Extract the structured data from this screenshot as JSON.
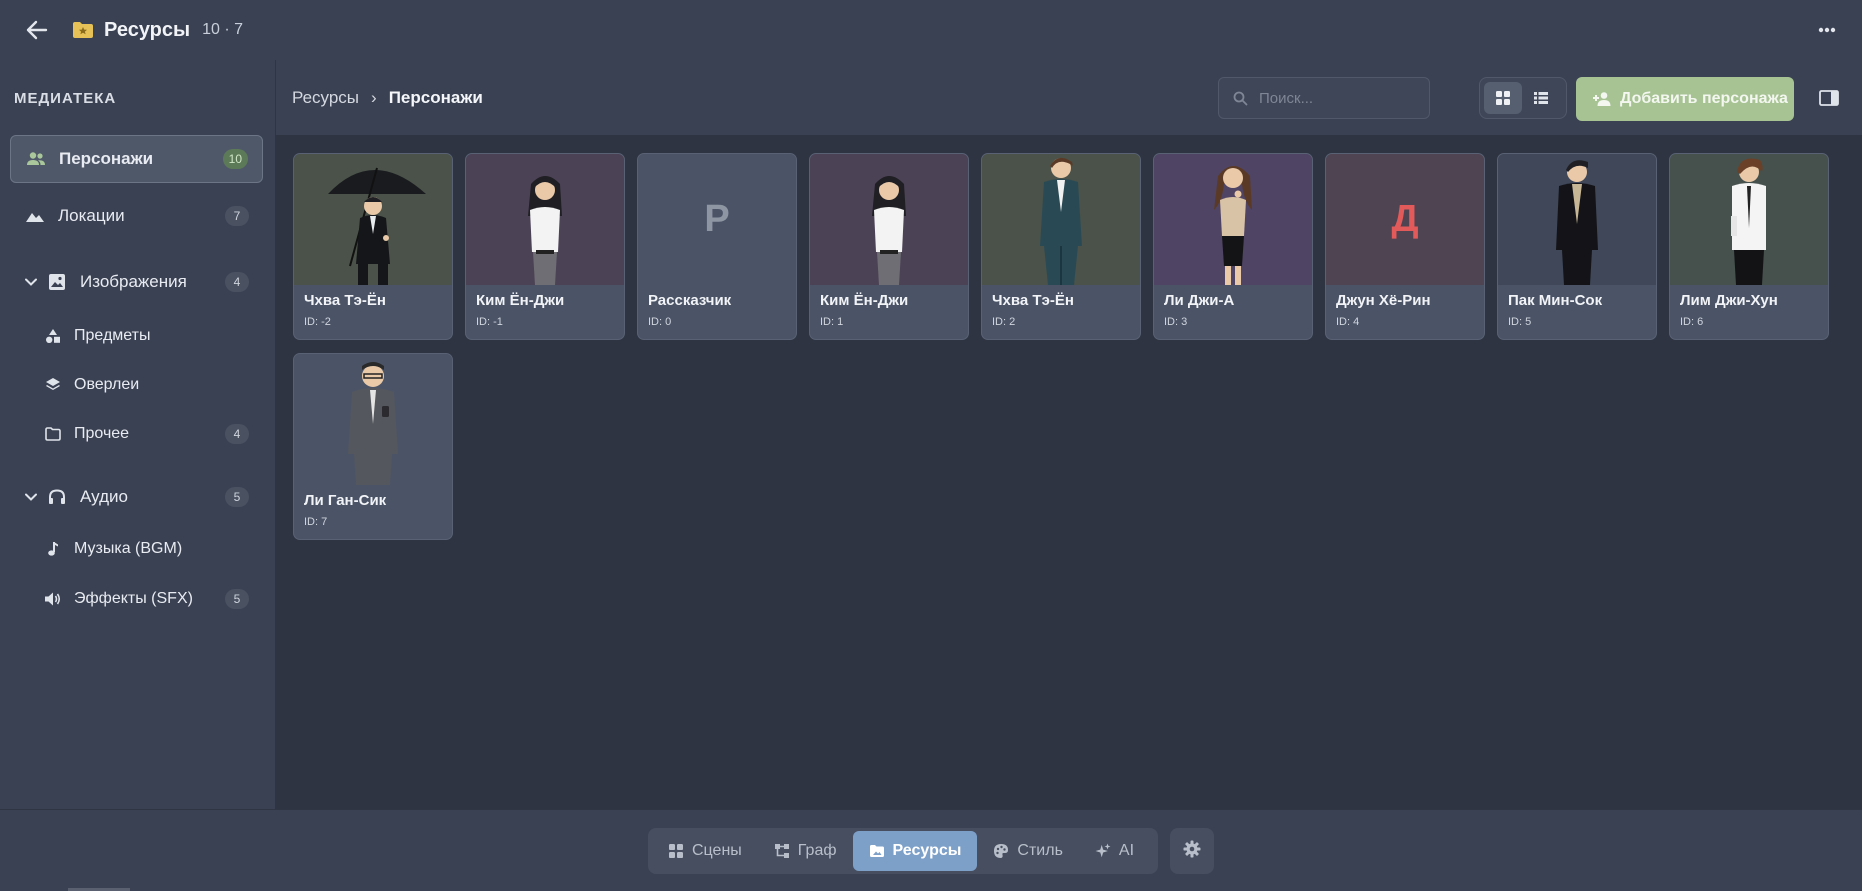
{
  "topbar": {
    "title": "Ресурсы",
    "counts": "10 · 7"
  },
  "sidebar": {
    "library_title": "МЕДИАТЕКА",
    "items": [
      {
        "label": "Персонажи",
        "count": "10",
        "active": true
      },
      {
        "label": "Локации",
        "count": "7"
      },
      {
        "label": "Изображения",
        "count": "4"
      },
      {
        "label": "Предметы"
      },
      {
        "label": "Оверлеи"
      },
      {
        "label": "Прочее",
        "count": "4"
      },
      {
        "label": "Аудио",
        "count": "5"
      },
      {
        "label": "Музыка (BGM)"
      },
      {
        "label": "Эффекты (SFX)",
        "count": "5"
      }
    ]
  },
  "breadcrumb": {
    "parent": "Ресурсы",
    "separator": "›",
    "current": "Персонажи"
  },
  "search": {
    "placeholder": "Поиск..."
  },
  "toolbar": {
    "add_label": "Добавить персонажа"
  },
  "characters": [
    {
      "name": "Чхва Тэ-Ён",
      "id": "ID: -2",
      "bg": "#4a5249",
      "kind": "umbrella"
    },
    {
      "name": "Ким Ён-Джи",
      "id": "ID: -1",
      "bg": "#4c4256",
      "kind": "girl"
    },
    {
      "name": "Рассказчик",
      "id": "ID: 0",
      "bg": "#4b5467",
      "kind": "letter",
      "letter": "Р",
      "letter_color": "#8e96a4"
    },
    {
      "name": "Ким Ён-Джи",
      "id": "ID: 1",
      "bg": "#4c4256",
      "kind": "girl"
    },
    {
      "name": "Чхва Тэ-Ён",
      "id": "ID: 2",
      "bg": "#4a5249",
      "kind": "suit-teal"
    },
    {
      "name": "Ли Джи-А",
      "id": "ID: 3",
      "bg": "#4f4463",
      "kind": "woman"
    },
    {
      "name": "Джун Хё-Рин",
      "id": "ID: 4",
      "bg": "#4f4452",
      "kind": "letter",
      "letter": "Д",
      "letter_color": "#e25a5a"
    },
    {
      "name": "Пак Мин-Сок",
      "id": "ID: 5",
      "bg": "#3f4758",
      "kind": "suit-black"
    },
    {
      "name": "Лим Джи-Хун",
      "id": "ID: 6",
      "bg": "#46514d",
      "kind": "casual"
    },
    {
      "name": "Ли Ган-Сик",
      "id": "ID: 7",
      "bg": "#4b5467",
      "kind": "old"
    }
  ],
  "bottom_nav": [
    {
      "label": "Сцены"
    },
    {
      "label": "Граф"
    },
    {
      "label": "Ресурсы",
      "active": true
    },
    {
      "label": "Стиль"
    },
    {
      "label": "AI"
    }
  ],
  "colors": {
    "accent_add": "#a7c394",
    "accent_nav": "#7da0c9",
    "folder": "#e5c158"
  }
}
